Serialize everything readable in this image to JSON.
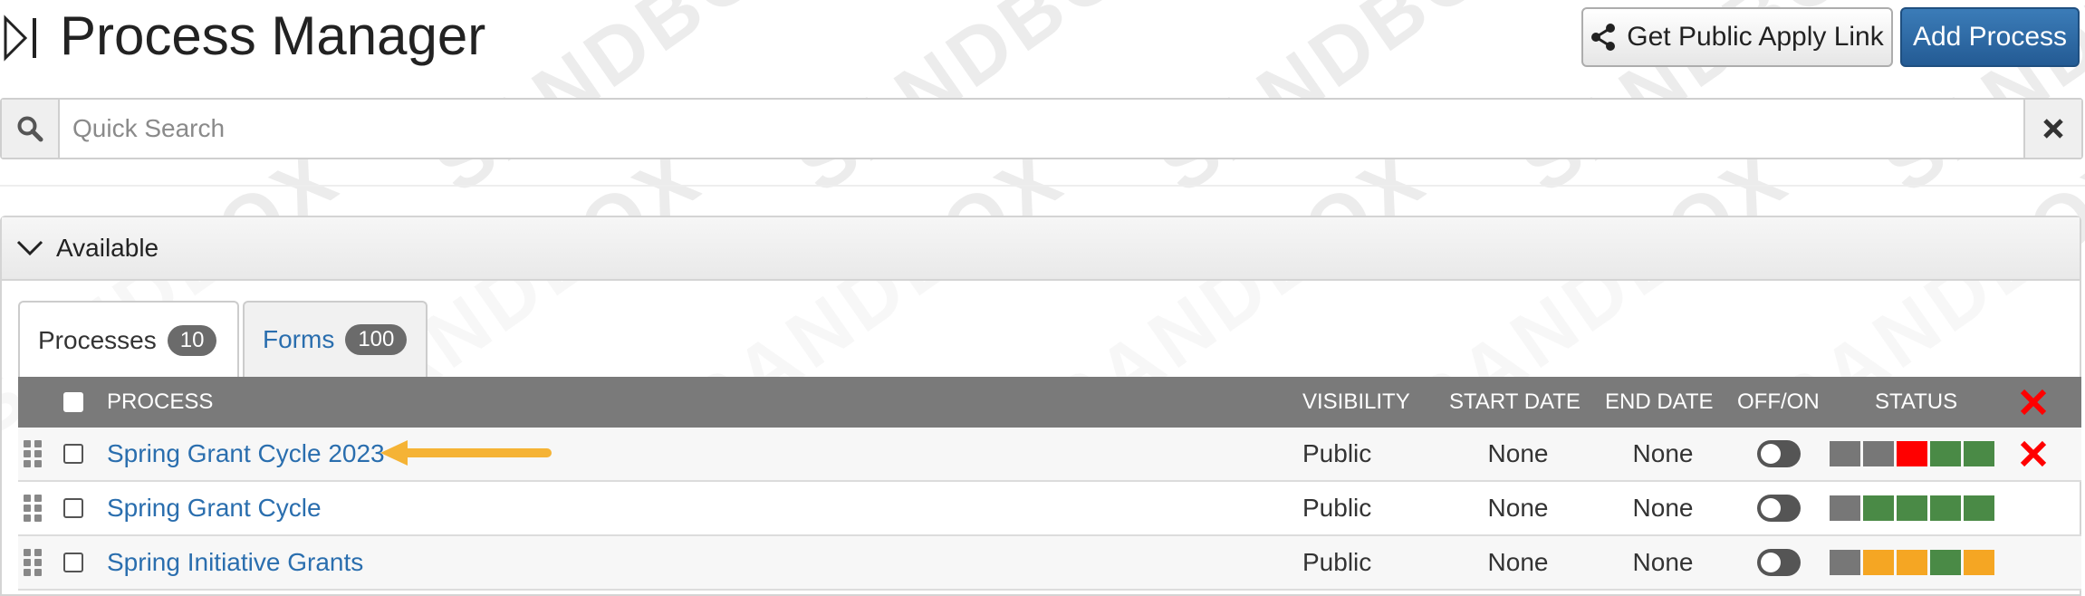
{
  "header": {
    "title": "Process Manager",
    "share_button": "Get Public Apply Link",
    "add_button": "Add Process"
  },
  "search": {
    "placeholder": "Quick Search",
    "value": ""
  },
  "watermark": "SANDBOX",
  "panel": {
    "title": "Available"
  },
  "tabs": [
    {
      "label": "Processes",
      "count": "10",
      "active": true
    },
    {
      "label": "Forms",
      "count": "100",
      "active": false
    }
  ],
  "table": {
    "columns": {
      "process": "PROCESS",
      "visibility": "VISIBILITY",
      "start_date": "START DATE",
      "end_date": "END DATE",
      "off_on": "OFF/ON",
      "status": "STATUS"
    },
    "rows": [
      {
        "name": "Spring Grant Cycle 2023",
        "visibility": "Public",
        "start_date": "None",
        "end_date": "None",
        "status": [
          "gray",
          "gray",
          "red",
          "green",
          "green"
        ],
        "deletable": true
      },
      {
        "name": "Spring Grant Cycle",
        "visibility": "Public",
        "start_date": "None",
        "end_date": "None",
        "status": [
          "gray",
          "green",
          "green",
          "green",
          "green"
        ],
        "deletable": false
      },
      {
        "name": "Spring Initiative Grants",
        "visibility": "Public",
        "start_date": "None",
        "end_date": "None",
        "status": [
          "gray",
          "orange",
          "orange",
          "green",
          "orange"
        ],
        "deletable": false
      }
    ]
  },
  "colors": {
    "gray": "#777777",
    "green": "#4a8a46",
    "red": "#ff0000",
    "orange": "#f5a623",
    "link": "#2a6eae",
    "primary": "#2a66a3",
    "arrow": "#f5b335"
  },
  "icons": [
    "panel-toggle-icon",
    "share-icon",
    "search-icon",
    "clear-icon",
    "chevron-down-icon",
    "drag-handle-icon",
    "delete-x-icon",
    "annotation-arrow"
  ]
}
